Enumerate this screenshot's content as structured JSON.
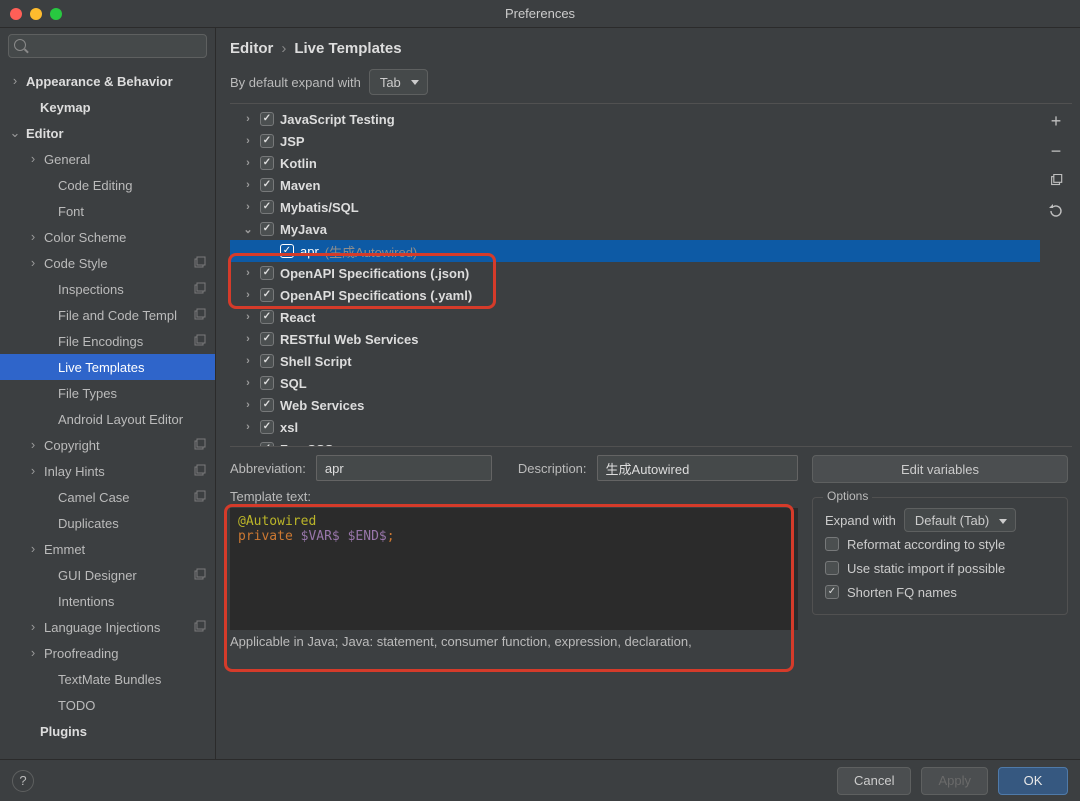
{
  "window": {
    "title": "Preferences"
  },
  "search": {
    "placeholder": ""
  },
  "breadcrumb": {
    "a": "Editor",
    "sep": "›",
    "b": "Live Templates"
  },
  "expand": {
    "label": "By default expand with",
    "value": "Tab"
  },
  "sidebar": {
    "items": [
      {
        "label": "Appearance & Behavior",
        "bold": true,
        "arrow": ">",
        "pad": 0
      },
      {
        "label": "Keymap",
        "bold": true,
        "arrow": "",
        "pad": 14
      },
      {
        "label": "Editor",
        "bold": true,
        "arrow": "v",
        "pad": 0
      },
      {
        "label": "General",
        "arrow": ">",
        "pad": 18
      },
      {
        "label": "Code Editing",
        "arrow": "",
        "pad": 32
      },
      {
        "label": "Font",
        "arrow": "",
        "pad": 32
      },
      {
        "label": "Color Scheme",
        "arrow": ">",
        "pad": 18
      },
      {
        "label": "Code Style",
        "arrow": ">",
        "pad": 18,
        "stack": true
      },
      {
        "label": "Inspections",
        "arrow": "",
        "pad": 32,
        "stack": true
      },
      {
        "label": "File and Code Templ",
        "arrow": "",
        "pad": 32,
        "stack": true
      },
      {
        "label": "File Encodings",
        "arrow": "",
        "pad": 32,
        "stack": true
      },
      {
        "label": "Live Templates",
        "arrow": "",
        "pad": 32,
        "sel": true
      },
      {
        "label": "File Types",
        "arrow": "",
        "pad": 32
      },
      {
        "label": "Android Layout Editor",
        "arrow": "",
        "pad": 32
      },
      {
        "label": "Copyright",
        "arrow": ">",
        "pad": 18,
        "stack": true
      },
      {
        "label": "Inlay Hints",
        "arrow": ">",
        "pad": 18,
        "stack": true
      },
      {
        "label": "Camel Case",
        "arrow": "",
        "pad": 32,
        "stack": true
      },
      {
        "label": "Duplicates",
        "arrow": "",
        "pad": 32
      },
      {
        "label": "Emmet",
        "arrow": ">",
        "pad": 18
      },
      {
        "label": "GUI Designer",
        "arrow": "",
        "pad": 32,
        "stack": true
      },
      {
        "label": "Intentions",
        "arrow": "",
        "pad": 32
      },
      {
        "label": "Language Injections",
        "arrow": ">",
        "pad": 18,
        "stack": true
      },
      {
        "label": "Proofreading",
        "arrow": ">",
        "pad": 18
      },
      {
        "label": "TextMate Bundles",
        "arrow": "",
        "pad": 32
      },
      {
        "label": "TODO",
        "arrow": "",
        "pad": 32
      },
      {
        "label": "Plugins",
        "bold": true,
        "arrow": "",
        "pad": 14
      }
    ]
  },
  "templates": {
    "items": [
      {
        "label": "JavaScript Testing",
        "arrow": ">",
        "checked": true
      },
      {
        "label": "JSP",
        "arrow": ">",
        "checked": true
      },
      {
        "label": "Kotlin",
        "arrow": ">",
        "checked": true
      },
      {
        "label": "Maven",
        "arrow": ">",
        "checked": true
      },
      {
        "label": "Mybatis/SQL",
        "arrow": ">",
        "checked": true
      },
      {
        "label": "MyJava",
        "arrow": "v",
        "checked": true
      },
      {
        "label": "apr",
        "suffix": "(生成Autowired)",
        "child": true,
        "checked": true,
        "sel": true
      },
      {
        "label": "OpenAPI Specifications (.json)",
        "arrow": ">",
        "checked": true
      },
      {
        "label": "OpenAPI Specifications (.yaml)",
        "arrow": ">",
        "checked": true
      },
      {
        "label": "React",
        "arrow": ">",
        "checked": true
      },
      {
        "label": "RESTful Web Services",
        "arrow": ">",
        "checked": true
      },
      {
        "label": "Shell Script",
        "arrow": ">",
        "checked": true
      },
      {
        "label": "SQL",
        "arrow": ">",
        "checked": true
      },
      {
        "label": "Web Services",
        "arrow": ">",
        "checked": true
      },
      {
        "label": "xsl",
        "arrow": ">",
        "checked": true
      },
      {
        "label": "Zen CSS",
        "arrow": ">",
        "checked": true
      }
    ]
  },
  "tools": {
    "add": "+",
    "remove": "−",
    "dup": "⧉",
    "revert": "↺"
  },
  "detail": {
    "abbr_label": "Abbreviation:",
    "abbr_value": "apr",
    "desc_label": "Description:",
    "desc_value": "生成Autowired",
    "tmpl_label": "Template text:",
    "code": {
      "line1_k": "@Autowired",
      "line2_k": "private",
      "line2_v": "$VAR$ $END$",
      "line2_sc": ";"
    },
    "edit_vars": "Edit variables",
    "options_title": "Options",
    "expand_label": "Expand with",
    "expand_value": "Default (Tab)",
    "opt1": "Reformat according to style",
    "opt2": "Use static import if possible",
    "opt3": "Shorten FQ names"
  },
  "applicable": "Applicable in Java; Java: statement, consumer function, expression, declaration,",
  "footer": {
    "cancel": "Cancel",
    "apply": "Apply",
    "ok": "OK"
  }
}
